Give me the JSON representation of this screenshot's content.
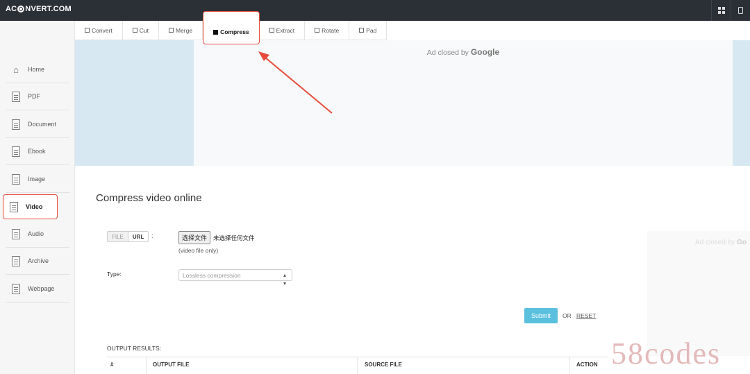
{
  "header": {
    "logo_prefix": "AC",
    "logo_suffix": "NVERT.COM",
    "icons": [
      "grid-icon",
      "mobile-icon"
    ]
  },
  "sidebar": {
    "items": [
      {
        "label": "Home",
        "icon": "home-icon"
      },
      {
        "label": "PDF",
        "icon": "pdf-icon"
      },
      {
        "label": "Document",
        "icon": "document-icon"
      },
      {
        "label": "Ebook",
        "icon": "ebook-icon"
      },
      {
        "label": "Image",
        "icon": "image-icon"
      },
      {
        "label": "Video",
        "icon": "video-icon",
        "active": true
      },
      {
        "label": "Audio",
        "icon": "audio-icon"
      },
      {
        "label": "Archive",
        "icon": "archive-icon"
      },
      {
        "label": "Webpage",
        "icon": "webpage-icon"
      }
    ]
  },
  "tabs": [
    {
      "label": "Convert"
    },
    {
      "label": "Cut"
    },
    {
      "label": "Merge"
    },
    {
      "label": "Compress",
      "active": true
    },
    {
      "label": "Extract"
    },
    {
      "label": "Rotate"
    },
    {
      "label": "Pad"
    }
  ],
  "ad": {
    "closed_by": "Ad closed by",
    "brand": "Google"
  },
  "main": {
    "title": "Compress video online",
    "source_toggle": {
      "file": "FILE",
      "url": "URL"
    },
    "colon": ":",
    "file_button": "选择文件",
    "file_status": "未选择任何文件",
    "hint": "(video file only)",
    "type_label": "Type:",
    "type_value": "Lossless compression",
    "submit": "Submit",
    "or": "OR",
    "reset": "RESET",
    "output_title": "OUTPUT RESULTS:",
    "table_headers": [
      "#",
      "OUTPUT FILE",
      "SOURCE FILE",
      "ACTION"
    ]
  },
  "right_ad": {
    "closed_by": "Ad closed by",
    "brand": "Go"
  },
  "watermark": "58codes",
  "colors": {
    "topbar": "#2b2f36",
    "highlight": "#e74c3c",
    "submit": "#5bc0de",
    "ad_band": "#d8e8f3"
  }
}
